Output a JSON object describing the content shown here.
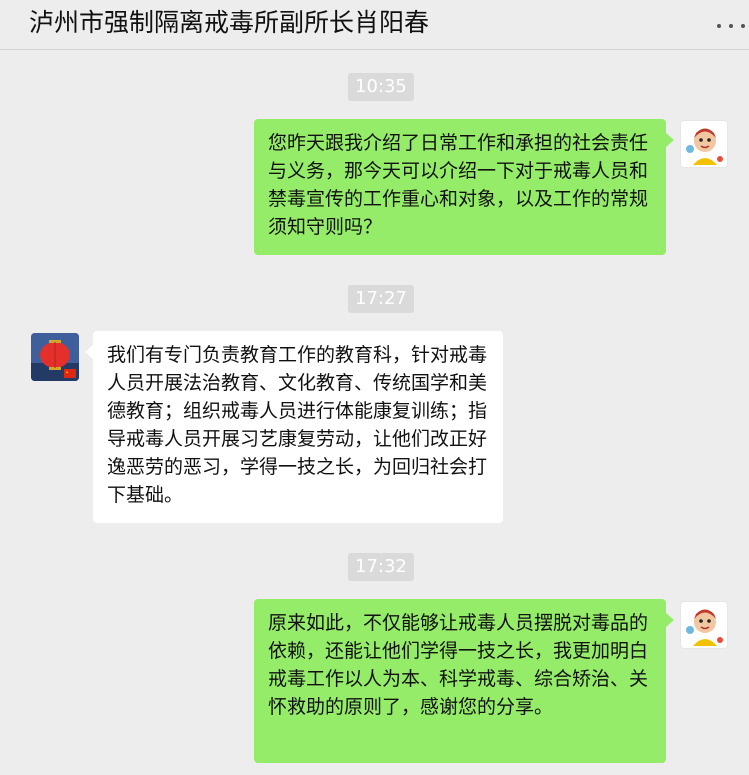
{
  "header": {
    "title": "泸州市强制隔离戒毒所副所长肖阳春"
  },
  "messages": [
    {
      "time": "10:35",
      "sender": "self",
      "text": "您昨天跟我介绍了日常工作和承担的社会责任与义务，那今天可以介绍一下对于戒毒人员和禁毒宣传的工作重心和对象，以及工作的常规须知守则吗？"
    },
    {
      "time": "17:27",
      "sender": "other",
      "text": "我们有专门负责教育工作的教育科，针对戒毒人员开展法治教育、文化教育、传统国学和美德教育；组织戒毒人员进行体能康复训练；指导戒毒人员开展习艺康复劳动，让他们改正好逸恶劳的恶习，学得一技之长，为回归社会打下基础。"
    },
    {
      "time": "17:32",
      "sender": "self",
      "text": "原来如此，不仅能够让戒毒人员摆脱对毒品的依赖，还能让他们学得一技之长，我更加明白戒毒工作以人为本、科学戒毒、综合矫治、关怀救助的原则了，感谢您的分享。"
    }
  ],
  "icons": {
    "more": "more-dots-icon",
    "self_avatar": "cartoon-avatar",
    "other_avatar": "lantern-avatar"
  },
  "colors": {
    "background": "#ededed",
    "self_bubble": "#95ec69",
    "other_bubble": "#ffffff",
    "timestamp_bg": "#dadada"
  }
}
